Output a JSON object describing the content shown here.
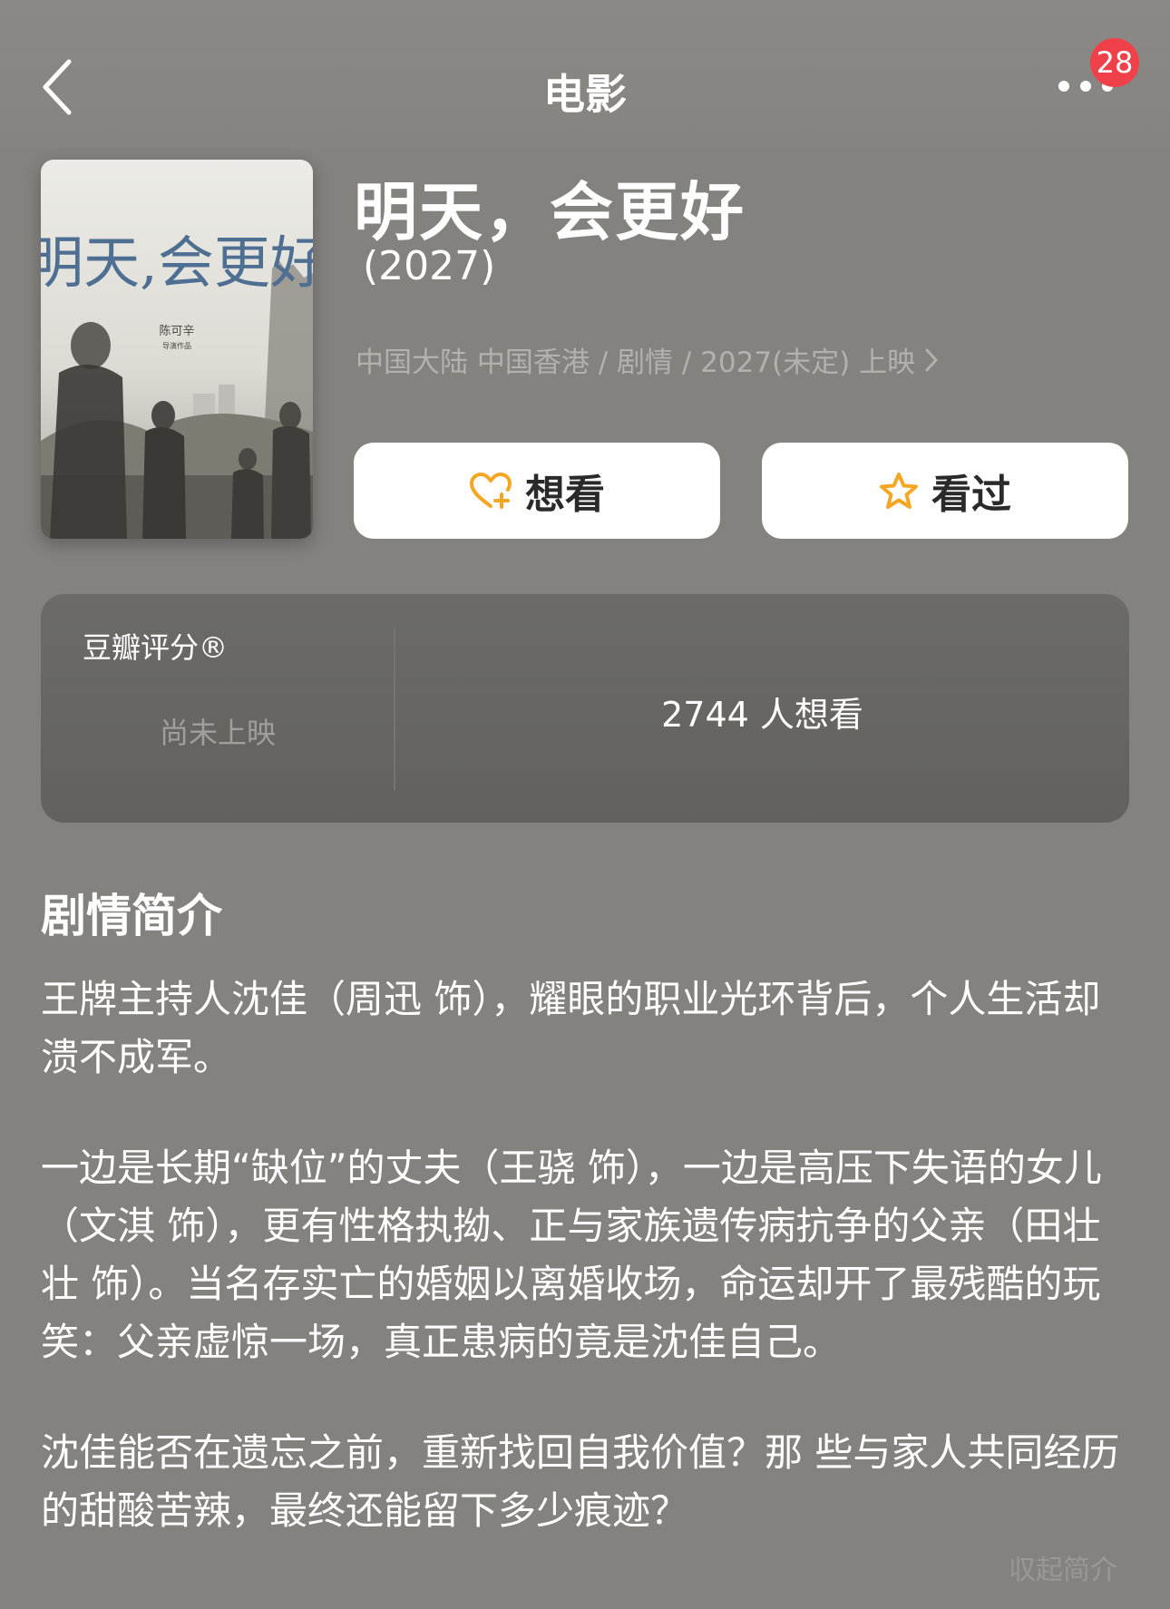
{
  "nav": {
    "title": "电影",
    "notification_count": "28"
  },
  "poster": {
    "title_art": "明天,会更好",
    "credit_line1": "陈可辛",
    "credit_line2": "导演作品"
  },
  "movie": {
    "title": "明天，会更好",
    "year": "(2027)",
    "meta": "中国大陆 中国香港 / 剧情 / 2027(未定) 上映"
  },
  "actions": {
    "want_label": "想看",
    "seen_label": "看过"
  },
  "rating": {
    "label": "豆瓣评分®",
    "status": "尚未上映",
    "want_count": "2744 人想看"
  },
  "synopsis": {
    "title": "剧情简介",
    "paragraphs": [
      "王牌主持人沈佳（周迅 饰），耀眼的职业光环背后，个人生活却溃不成军。",
      "一边是长期“缺位”的丈夫（王骁 饰），一边是高压下失语的女儿（文淇 饰），更有性格执拗、正与家族遗传病抗争的父亲（田壮壮 饰）。当名存实亡的婚姻以离婚收场，命运却开了最残酷的玩笑：父亲虚惊一场，真正患病的竟是沈佳自己。",
      "沈佳能否在遗忘之前，重新找回自我价值？那 些与家人共同经历的甜酸苦辣，最终还能留下多少痕迹？"
    ],
    "collapse_label": "収起简介"
  },
  "colors": {
    "background": "#84827e",
    "card": "#656460",
    "accent_icon": "#f5a623",
    "badge": "#f0404a"
  }
}
